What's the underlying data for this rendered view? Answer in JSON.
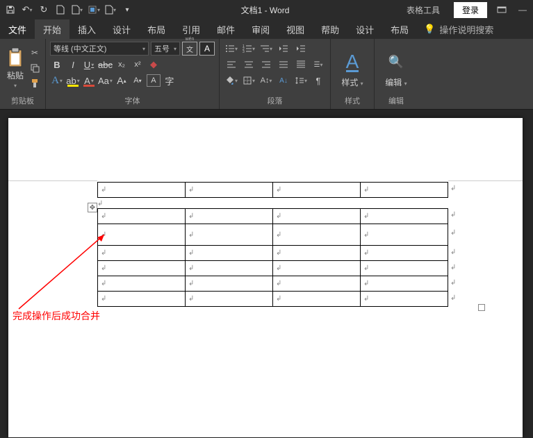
{
  "title": "文档1 - Word",
  "titlebar_right": {
    "table_tools": "表格工具",
    "login": "登录"
  },
  "menu": {
    "file": "文件",
    "home": "开始",
    "insert": "插入",
    "design": "设计",
    "layout": "布局",
    "references": "引用",
    "mailings": "邮件",
    "review": "审阅",
    "view": "视图",
    "help": "帮助",
    "tbl_design": "设计",
    "tbl_layout": "布局",
    "search": "操作说明搜索"
  },
  "groups": {
    "clipboard": "剪贴板",
    "font": "字体",
    "paragraph": "段落",
    "styles": "样式",
    "editing": "编辑"
  },
  "clipboard": {
    "paste": "粘贴"
  },
  "font": {
    "name": "等线 (中文正文)",
    "size": "五号",
    "bold": "B",
    "italic": "I",
    "underline": "U",
    "strike": "abc",
    "sub": "x₂",
    "sup": "x²",
    "texteffect": "A",
    "highlight": "ab",
    "color": "A",
    "change_case": "Aa",
    "phonetic": "A",
    "grow": "A",
    "shrink": "A",
    "border": "A",
    "shade": "A",
    "clear": "◆",
    "bigA": "A"
  },
  "styles": {
    "label": "样式"
  },
  "editing": {
    "label": "编辑"
  },
  "annotation": "完成操作后成功合并",
  "cell_mark": "↲"
}
